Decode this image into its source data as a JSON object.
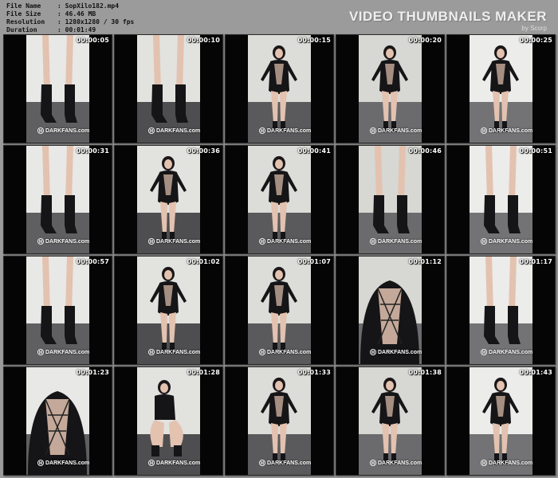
{
  "info": {
    "file_name_label": "File Name",
    "file_name_value": ": SopXilo182.mp4",
    "file_size_label": "File Size",
    "file_size_value": ": 46.46 MB",
    "resolution_label": "Resolution",
    "resolution_value": ": 1280x1280 / 30 fps",
    "duration_label": "Duration",
    "duration_value": ": 00:01:49"
  },
  "brand": {
    "title": "VIDEO THUMBNAILS MAKER",
    "subtitle": "by Scorp"
  },
  "watermark": "DARKFANS.com",
  "thumbnails": [
    {
      "timestamp": "00:00:05",
      "scene": "boots-closeup"
    },
    {
      "timestamp": "00:00:10",
      "scene": "boots-legs"
    },
    {
      "timestamp": "00:00:15",
      "scene": "full-body"
    },
    {
      "timestamp": "00:00:20",
      "scene": "full-body-back"
    },
    {
      "timestamp": "00:00:25",
      "scene": "full-body"
    },
    {
      "timestamp": "00:00:31",
      "scene": "legs"
    },
    {
      "timestamp": "00:00:36",
      "scene": "full-body"
    },
    {
      "timestamp": "00:00:41",
      "scene": "full-body"
    },
    {
      "timestamp": "00:00:46",
      "scene": "boots-closeup"
    },
    {
      "timestamp": "00:00:51",
      "scene": "boots-closeup"
    },
    {
      "timestamp": "00:00:57",
      "scene": "legs"
    },
    {
      "timestamp": "00:01:02",
      "scene": "full-body"
    },
    {
      "timestamp": "00:01:07",
      "scene": "full-body"
    },
    {
      "timestamp": "00:01:12",
      "scene": "torso-closeup"
    },
    {
      "timestamp": "00:01:17",
      "scene": "boots-closeup"
    },
    {
      "timestamp": "00:01:23",
      "scene": "torso-closeup"
    },
    {
      "timestamp": "00:01:28",
      "scene": "crouch"
    },
    {
      "timestamp": "00:01:33",
      "scene": "full-body"
    },
    {
      "timestamp": "00:01:38",
      "scene": "full-body-back"
    },
    {
      "timestamp": "00:01:43",
      "scene": "full-body"
    }
  ],
  "colors": {
    "sheet_background": "#9b9b9b",
    "brand_text": "#eeeeee",
    "timestamp_text": "#ffffff"
  }
}
